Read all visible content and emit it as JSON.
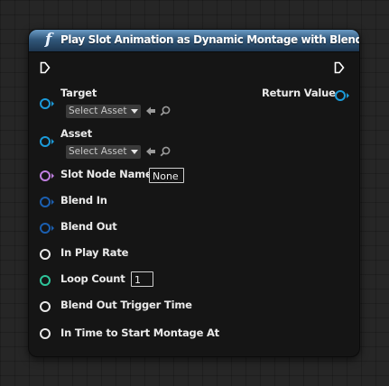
{
  "node": {
    "title": "Play Slot Animation as Dynamic Montage with Blend Args",
    "title_icon": "function-icon",
    "accent": "#31577a"
  },
  "outputs": {
    "return_value_label": "Return Value"
  },
  "inputs": {
    "target_label": "Target",
    "target_select": "Select Asset",
    "asset_label": "Asset",
    "asset_select": "Select Asset",
    "slot_node_name_label": "Slot Node Name",
    "slot_node_name_value": "None",
    "blend_in_label": "Blend In",
    "blend_out_label": "Blend Out",
    "in_play_rate_label": "In Play Rate",
    "loop_count_label": "Loop Count",
    "loop_count_value": "1",
    "blend_out_trigger_time_label": "Blend Out Trigger Time",
    "in_time_to_start_label": "In Time to Start Montage At"
  },
  "colors": {
    "object_pin": "#1b9ad9",
    "name_pin": "#c07fe0",
    "struct_pin": "#1b5fb0",
    "float_pin": "#e8e8e8",
    "int_pin": "#2ec49a"
  }
}
